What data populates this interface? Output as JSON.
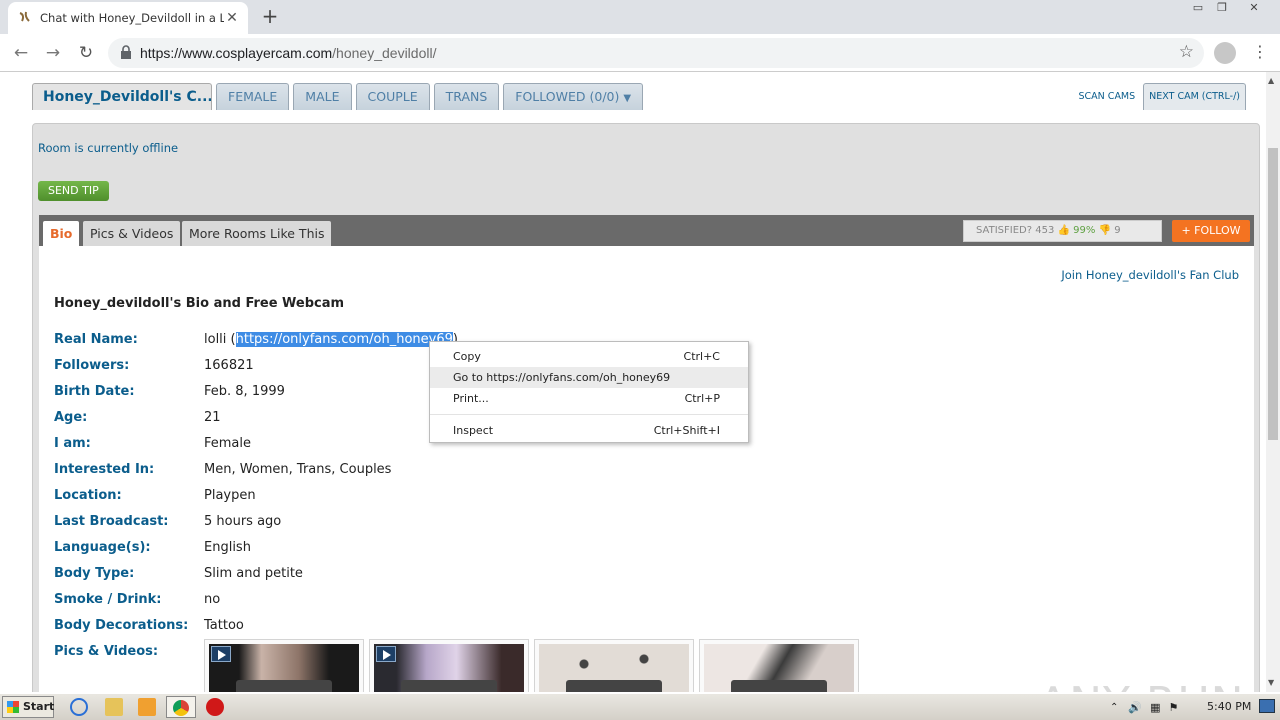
{
  "browser": {
    "tab_title": "Chat with Honey_Devildoll in a Live A",
    "url_host": "https://www.cosplayercam.com",
    "url_path": "/honey_devildoll/"
  },
  "site": {
    "tabs": [
      "Honey_Devildoll's C...",
      "FEMALE",
      "MALE",
      "COUPLE",
      "TRANS",
      "FOLLOWED (0/0)"
    ],
    "scan_cams": "SCAN CAMS",
    "next_cam": "NEXT CAM (CTRL-/)",
    "offline": "Room is currently offline",
    "send_tip": "SEND TIP"
  },
  "bio_tabs": [
    "Bio",
    "Pics & Videos",
    "More Rooms Like This"
  ],
  "satisfied": {
    "label": "SATISFIED?",
    "count": "453",
    "pct": "99%",
    "down": "9"
  },
  "follow": "+ FOLLOW",
  "fan_club": "Join Honey_devildoll's Fan Club",
  "bio_title": "Honey_devildoll's Bio and Free Webcam",
  "real_name": {
    "label": "Real Name:",
    "prefix": "lolli (",
    "link": "https://onlyfans.com/oh_honey69",
    "suffix": ")"
  },
  "rows": [
    {
      "label": "Followers:",
      "value": "166821"
    },
    {
      "label": "Birth Date:",
      "value": "Feb. 8, 1999"
    },
    {
      "label": "Age:",
      "value": "21"
    },
    {
      "label": "I am:",
      "value": "Female"
    },
    {
      "label": "Interested In:",
      "value": "Men, Women, Trans, Couples"
    },
    {
      "label": "Location:",
      "value": "Playpen"
    },
    {
      "label": "Last Broadcast:",
      "value": "5 hours ago"
    },
    {
      "label": "Language(s):",
      "value": "English"
    },
    {
      "label": "Body Type:",
      "value": "Slim and petite"
    },
    {
      "label": "Smoke / Drink:",
      "value": "no"
    },
    {
      "label": "Body Decorations:",
      "value": "Tattoo"
    },
    {
      "label": "Pics & Videos:",
      "value": ""
    }
  ],
  "context_menu": [
    {
      "label": "Copy",
      "shortcut": "Ctrl+C"
    },
    {
      "label": "Go to https://onlyfans.com/oh_honey69",
      "shortcut": ""
    },
    {
      "label": "Print...",
      "shortcut": "Ctrl+P"
    },
    {
      "label": "Inspect",
      "shortcut": "Ctrl+Shift+I"
    }
  ],
  "watermark": "ANY RUN",
  "taskbar": {
    "start": "Start",
    "clock": "5:40 PM"
  }
}
